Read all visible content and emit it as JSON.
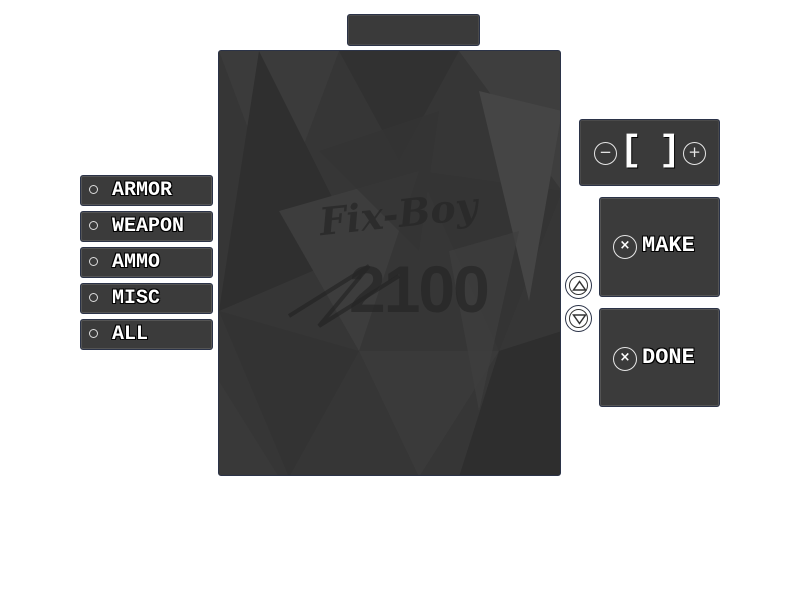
{
  "title_bar": {
    "text": ""
  },
  "main_display": {
    "logo_script": "Fix-Boy",
    "logo_number": "2100"
  },
  "categories": [
    {
      "label": "ARMOR"
    },
    {
      "label": "WEAPON"
    },
    {
      "label": "AMMO"
    },
    {
      "label": "MISC"
    },
    {
      "label": "ALL"
    }
  ],
  "quantity": {
    "left_bracket": "[",
    "right_bracket": "]",
    "value": "",
    "minus_symbol": "−",
    "plus_symbol": "+"
  },
  "actions": {
    "make": {
      "label": "MAKE",
      "icon": "close-circle-icon",
      "symbol": "×"
    },
    "done": {
      "label": "DONE",
      "icon": "close-circle-icon",
      "symbol": "×"
    }
  },
  "colors": {
    "panel_background": "#383838",
    "panel_border": "#2b3348",
    "text": "#ffffff"
  }
}
